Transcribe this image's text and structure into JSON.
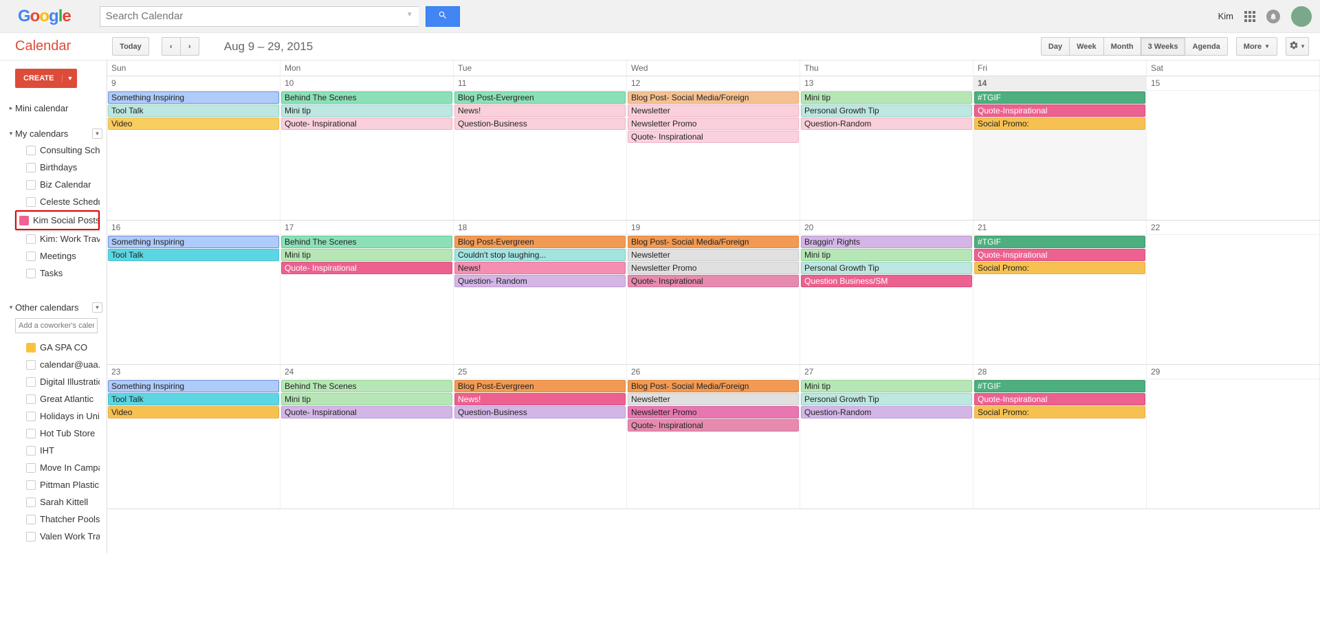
{
  "header": {
    "logo": "Google",
    "search_placeholder": "Search Calendar",
    "user_name": "Kim"
  },
  "toolbar": {
    "app_title": "Calendar",
    "today": "Today",
    "date_range": "Aug 9 – 29, 2015",
    "views": [
      "Day",
      "Week",
      "Month",
      "3 Weeks",
      "Agenda"
    ],
    "active_view": "3 Weeks",
    "more": "More"
  },
  "sidebar": {
    "create": "CREATE",
    "mini_calendar": "Mini calendar",
    "my_calendars_label": "My calendars",
    "my_calendars": [
      "Consulting Schedule",
      "Birthdays",
      "Biz Calendar",
      "Celeste Schedule",
      "Kim Social Posts Ideas",
      "Kim: Work Traveling ...",
      "Meetings",
      "Tasks"
    ],
    "highlighted_index": 4,
    "other_calendars_label": "Other calendars",
    "add_coworker_placeholder": "Add a coworker's calendar",
    "other_calendars": [
      {
        "label": "GA SPA CO",
        "fill": "#FAC23C"
      },
      {
        "label": "calendar@uaa.edu",
        "fill": ""
      },
      {
        "label": "Digital Illustration: C...",
        "fill": ""
      },
      {
        "label": "Great Atlantic",
        "fill": ""
      },
      {
        "label": "Holidays in United St...",
        "fill": ""
      },
      {
        "label": "Hot Tub Store",
        "fill": ""
      },
      {
        "label": "IHT",
        "fill": ""
      },
      {
        "label": "Move In Campaign",
        "fill": ""
      },
      {
        "label": "Pittman Plastic Social",
        "fill": ""
      },
      {
        "label": "Sarah Kittell",
        "fill": ""
      },
      {
        "label": "Thatcher Pools",
        "fill": ""
      },
      {
        "label": "Valen Work Travelin...",
        "fill": ""
      }
    ]
  },
  "day_headers": [
    "Sun",
    "Mon",
    "Tue",
    "Wed",
    "Thu",
    "Fri",
    "Sat"
  ],
  "today_date": 14,
  "weeks": [
    {
      "days": [
        {
          "num": 9,
          "events": [
            {
              "t": "Something Inspiring",
              "c": "c-blue"
            },
            {
              "t": "Tool Talk",
              "c": "c-cyan"
            },
            {
              "t": "Video",
              "c": "c-yellow"
            }
          ]
        },
        {
          "num": 10,
          "events": [
            {
              "t": "Behind The Scenes",
              "c": "c-green"
            },
            {
              "t": "Mini tip",
              "c": "c-cyan"
            },
            {
              "t": "Quote- Inspirational",
              "c": "c-rose"
            }
          ]
        },
        {
          "num": 11,
          "events": [
            {
              "t": "Blog Post-Evergreen",
              "c": "c-green"
            },
            {
              "t": "News!",
              "c": "c-rose"
            },
            {
              "t": "Question-Business",
              "c": "c-rose"
            }
          ]
        },
        {
          "num": 12,
          "events": [
            {
              "t": "Blog Post- Social Media/Foreign",
              "c": "c-orange2"
            },
            {
              "t": "Newsletter",
              "c": "c-rose"
            },
            {
              "t": "Newsletter Promo",
              "c": "c-rose"
            },
            {
              "t": "Quote- Inspirational",
              "c": "c-pinkl"
            }
          ]
        },
        {
          "num": 13,
          "events": [
            {
              "t": "Mini tip",
              "c": "c-greenlt"
            },
            {
              "t": "Personal Growth Tip",
              "c": "c-cyan"
            },
            {
              "t": "Question-Random",
              "c": "c-rose"
            }
          ]
        },
        {
          "num": 14,
          "events": [
            {
              "t": "#TGIF",
              "c": "c-greenbr"
            },
            {
              "t": "Quote-Inspirational",
              "c": "c-pinkbr"
            },
            {
              "t": "Social Promo:",
              "c": "c-yellowbr"
            }
          ]
        },
        {
          "num": 15,
          "events": []
        }
      ]
    },
    {
      "days": [
        {
          "num": 16,
          "events": [
            {
              "t": "Something Inspiring",
              "c": "c-blue"
            },
            {
              "t": "Tool Talk",
              "c": "c-teal2"
            }
          ]
        },
        {
          "num": 17,
          "events": [
            {
              "t": "Behind The Scenes",
              "c": "c-green"
            },
            {
              "t": "Mini tip",
              "c": "c-greenlt"
            },
            {
              "t": "Quote- Inspirational",
              "c": "c-pinkbr"
            }
          ]
        },
        {
          "num": 18,
          "events": [
            {
              "t": "Blog Post-Evergreen",
              "c": "c-orangebr"
            },
            {
              "t": "Couldn't stop laughing...",
              "c": "c-mint"
            },
            {
              "t": "News!",
              "c": "c-pink"
            },
            {
              "t": "Question- Random",
              "c": "c-purple"
            }
          ]
        },
        {
          "num": 19,
          "events": [
            {
              "t": "Blog Post- Social Media/Foreign",
              "c": "c-orangebr"
            },
            {
              "t": "Newsletter",
              "c": "c-gray"
            },
            {
              "t": "Newsletter Promo",
              "c": "c-gray"
            },
            {
              "t": "Quote- Inspirational",
              "c": "c-pinkd"
            }
          ]
        },
        {
          "num": 20,
          "events": [
            {
              "t": "Braggin' Rights",
              "c": "c-purple"
            },
            {
              "t": "Mini tip",
              "c": "c-greenlt"
            },
            {
              "t": "Personal Growth Tip",
              "c": "c-cyan"
            },
            {
              "t": "Question Business/SM",
              "c": "c-pinkbr"
            }
          ]
        },
        {
          "num": 21,
          "events": [
            {
              "t": "#TGIF",
              "c": "c-greenbr"
            },
            {
              "t": "Quote-Inspirational",
              "c": "c-pinkbr"
            },
            {
              "t": "Social Promo:",
              "c": "c-yellowbr"
            }
          ]
        },
        {
          "num": 22,
          "events": []
        }
      ]
    },
    {
      "days": [
        {
          "num": 23,
          "events": [
            {
              "t": "Something Inspiring",
              "c": "c-blue"
            },
            {
              "t": "Tool Talk",
              "c": "c-teal2"
            },
            {
              "t": "Video",
              "c": "c-yellowbr"
            }
          ]
        },
        {
          "num": 24,
          "events": [
            {
              "t": "Behind The Scenes",
              "c": "c-greenlt"
            },
            {
              "t": "Mini tip",
              "c": "c-greenlt"
            },
            {
              "t": "Quote- Inspirational",
              "c": "c-purple"
            }
          ]
        },
        {
          "num": 25,
          "events": [
            {
              "t": "Blog Post-Evergreen",
              "c": "c-orangebr"
            },
            {
              "t": "News!",
              "c": "c-pinkbr"
            },
            {
              "t": "Question-Business",
              "c": "c-purple"
            }
          ]
        },
        {
          "num": 26,
          "events": [
            {
              "t": "Blog Post- Social Media/Foreign",
              "c": "c-orangebr"
            },
            {
              "t": "Newsletter",
              "c": "c-gray"
            },
            {
              "t": "Newsletter Promo",
              "c": "c-magenta"
            },
            {
              "t": "Quote- Inspirational",
              "c": "c-pinkd"
            }
          ]
        },
        {
          "num": 27,
          "events": [
            {
              "t": "Mini tip",
              "c": "c-greenlt"
            },
            {
              "t": "Personal Growth Tip",
              "c": "c-cyan"
            },
            {
              "t": "Question-Random",
              "c": "c-purple"
            }
          ]
        },
        {
          "num": 28,
          "events": [
            {
              "t": "#TGIF",
              "c": "c-greenbr"
            },
            {
              "t": "Quote-Inspirational",
              "c": "c-pinkbr"
            },
            {
              "t": "Social Promo:",
              "c": "c-yellowbr"
            }
          ]
        },
        {
          "num": 29,
          "events": []
        }
      ]
    }
  ]
}
